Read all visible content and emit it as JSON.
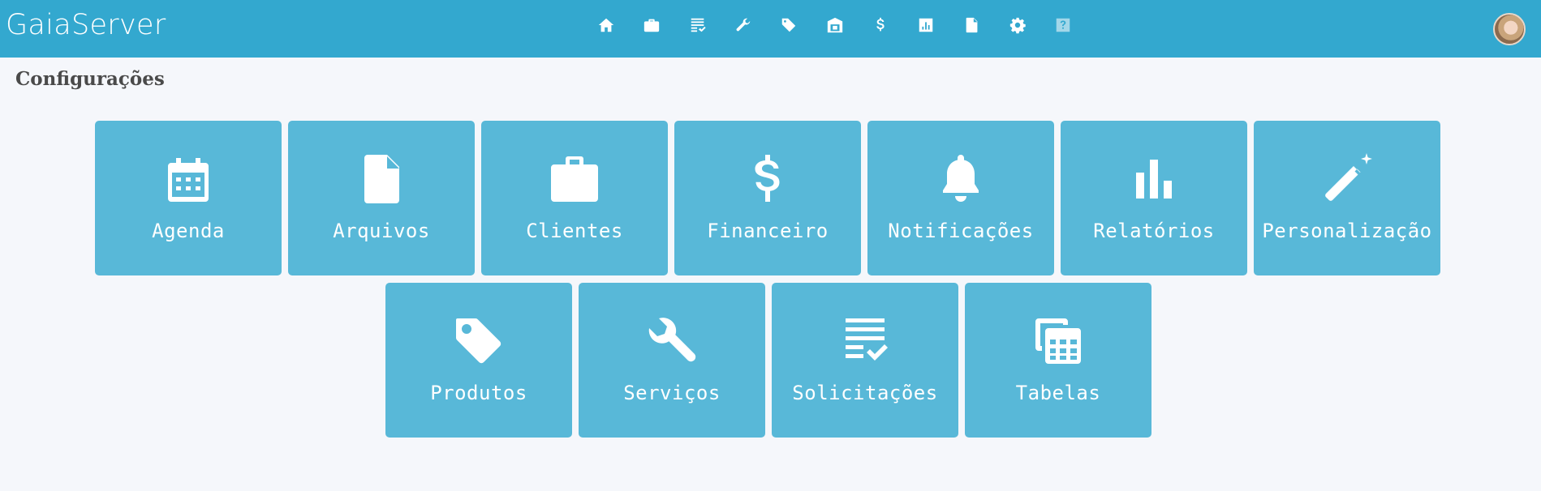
{
  "header": {
    "brand": "GaiaServer",
    "nav_icons": [
      "home-icon",
      "briefcase-icon",
      "checklist-icon",
      "wrench-icon",
      "tag-icon",
      "warehouse-icon",
      "dollar-icon",
      "chart-icon",
      "file-icon",
      "gear-icon",
      "help-icon"
    ],
    "avatar": "user-avatar"
  },
  "page": {
    "title": "Configurações"
  },
  "tiles": [
    {
      "label": "Agenda",
      "icon": "calendar-icon"
    },
    {
      "label": "Arquivos",
      "icon": "file-icon"
    },
    {
      "label": "Clientes",
      "icon": "briefcase-icon"
    },
    {
      "label": "Financeiro",
      "icon": "dollar-icon"
    },
    {
      "label": "Notificações",
      "icon": "bell-icon"
    },
    {
      "label": "Relatórios",
      "icon": "bar-chart-icon"
    },
    {
      "label": "Personalização",
      "icon": "magic-wand-icon"
    },
    {
      "label": "Produtos",
      "icon": "tag-icon"
    },
    {
      "label": "Serviços",
      "icon": "wrench-icon"
    },
    {
      "label": "Solicitações",
      "icon": "checklist-icon"
    },
    {
      "label": "Tabelas",
      "icon": "tables-icon"
    }
  ],
  "colors": {
    "header": "#33a8cf",
    "tile": "#58b8d8",
    "background": "#f5f7fb",
    "title_text": "#4a4a4a"
  }
}
